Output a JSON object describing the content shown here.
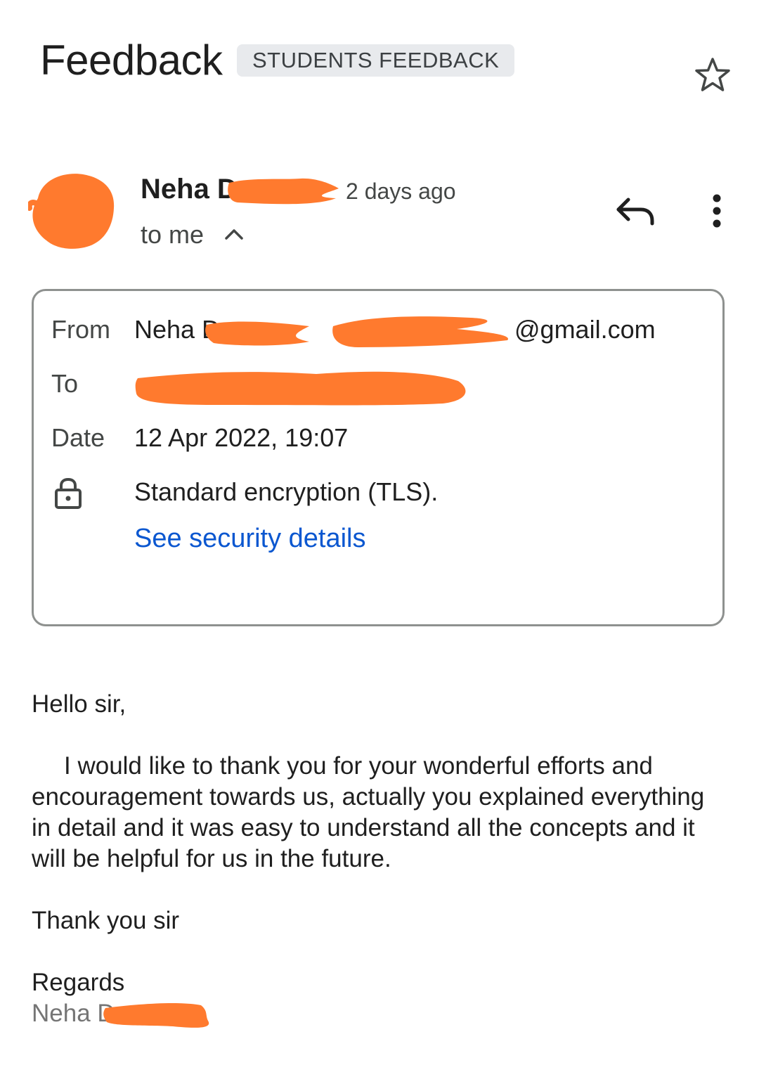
{
  "header": {
    "subject": "Feedback",
    "label": "STUDENTS FEEDBACK",
    "star_icon": "star-outline-icon"
  },
  "sender": {
    "name_visible": "Neha D",
    "time": "2 days ago",
    "recipient_summary": "to me",
    "avatar_icon": "avatar-redacted",
    "reply_icon": "reply-icon",
    "more_icon": "more-vert-icon"
  },
  "details": {
    "from_label": "From",
    "from_name_visible": "Neha D",
    "from_email_suffix": "@gmail.com",
    "to_label": "To",
    "date_label": "Date",
    "date_value": "12 Apr 2022, 19:07",
    "encryption": "Standard encryption (TLS).",
    "security_link": "See security details",
    "lock_icon": "lock-icon"
  },
  "body": {
    "greeting": "Hello sir,",
    "paragraph": "I would like to thank you for your wonderful efforts and encouragement towards us, actually  you explained everything in detail and it was easy to understand all the concepts and it will be helpful for us in the future.",
    "thanks": "Thank you sir",
    "regards": "Regards",
    "signature_visible": "Neha D"
  },
  "colors": {
    "redaction": "#ff7a2e",
    "link": "#0b57d0",
    "chip_bg": "#e8eaed",
    "border": "#8e918f"
  }
}
